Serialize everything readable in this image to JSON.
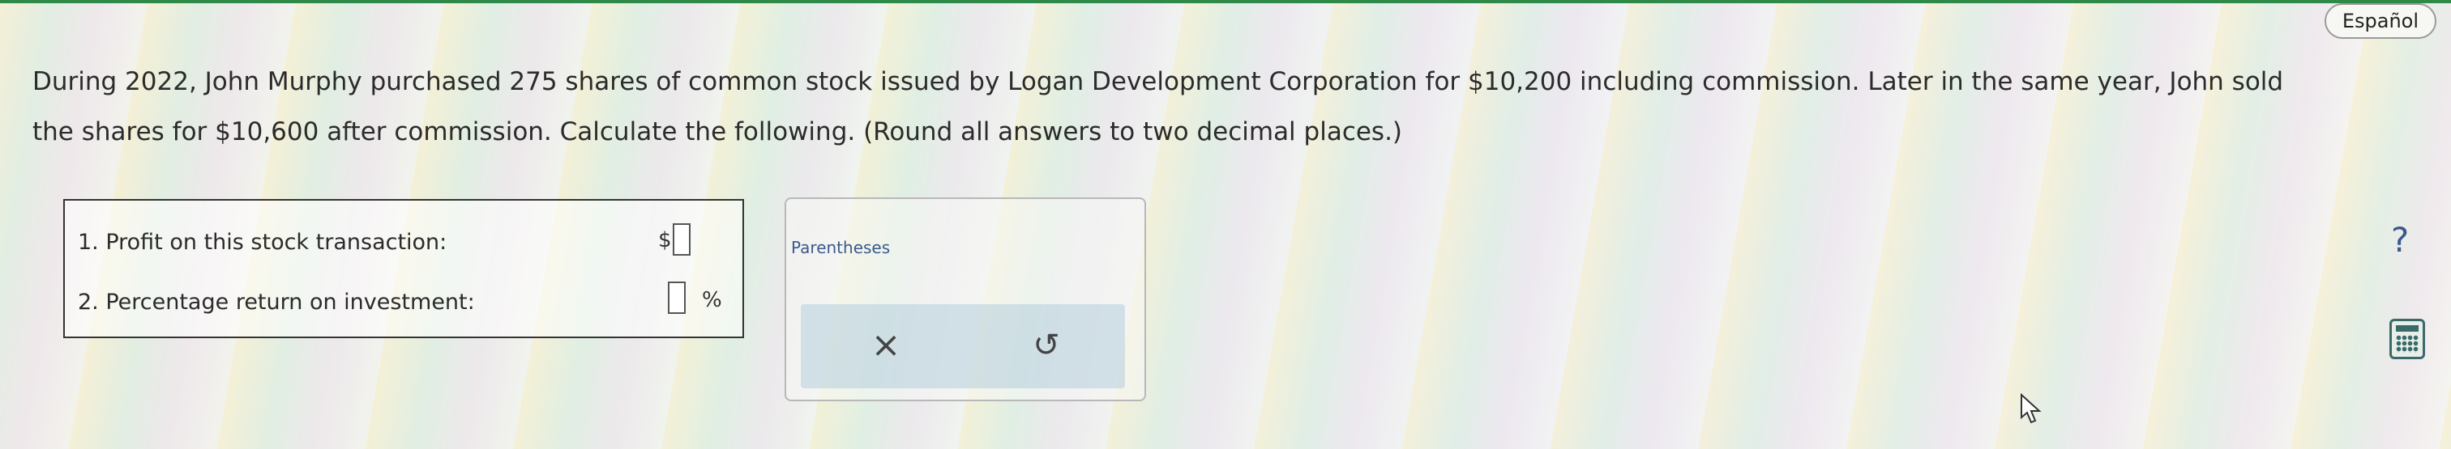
{
  "header": {
    "language_button": "Español"
  },
  "question": {
    "text": "During 2022, John Murphy purchased 275 shares of common stock issued by Logan Development Corporation for $10,200 including commission. Later in the same year, John sold the shares for $10,600 after commission. Calculate the following. (Round all answers to two decimal places.)"
  },
  "answers": [
    {
      "label": "1. Profit on this stock transaction:",
      "prefix": "$",
      "value": "",
      "suffix": ""
    },
    {
      "label": "2. Percentage return on investment:",
      "prefix": "",
      "value": "",
      "suffix": "%"
    }
  ],
  "tools": {
    "parentheses_label": "Parentheses",
    "clear_icon": "×",
    "undo_icon": "↺"
  },
  "side_icons": {
    "help": "?",
    "calculator": "calculator-icon"
  },
  "colors": {
    "accent": "#3a5a8c",
    "top_bar": "#2f8a4a"
  }
}
